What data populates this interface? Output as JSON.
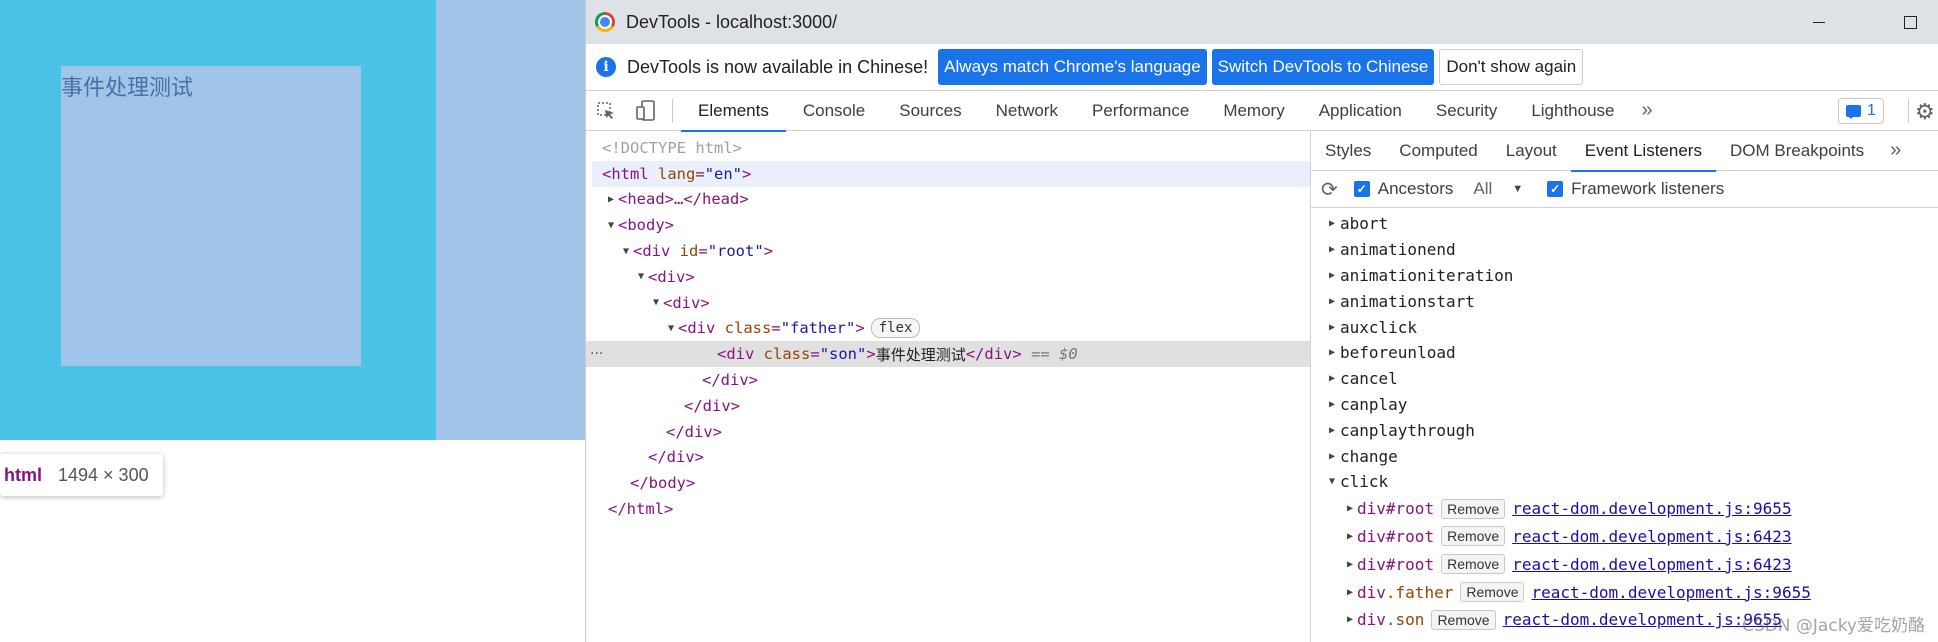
{
  "preview": {
    "son_text": "事件处理测试",
    "tooltip_tag": "html",
    "tooltip_size": "1494 × 300"
  },
  "window": {
    "title": "DevTools - localhost:3000/"
  },
  "infobar": {
    "message": "DevTools is now available in Chinese!",
    "btn_match": "Always match Chrome's language",
    "btn_switch": "Switch DevTools to Chinese",
    "btn_dismiss": "Don't show again"
  },
  "tabs": [
    "Elements",
    "Console",
    "Sources",
    "Network",
    "Performance",
    "Memory",
    "Application",
    "Security",
    "Lighthouse"
  ],
  "active_tab": "Elements",
  "more_tabs": "»",
  "issues_count": "1",
  "dom": {
    "doctype": "<!DOCTYPE html>",
    "html_tag": "<html",
    "html_attr": "lang",
    "html_val": "\"en\"",
    "head": "<head>…</head>",
    "body_open": "<body>",
    "div_open": "<div",
    "id_attr": "id",
    "root_val": "\"root\"",
    "div": "<div>",
    "class_attr": "class",
    "father_val": "\"father\"",
    "flex_badge": "flex",
    "son_val": "\"son\"",
    "son_text": "事件处理测试",
    "div_close": "</div>",
    "selected_marker": "== $0",
    "body_close": "</body>",
    "html_close": "</html>",
    "dots": "···"
  },
  "sidebar": {
    "tabs": [
      "Styles",
      "Computed",
      "Layout",
      "Event Listeners",
      "DOM Breakpoints"
    ],
    "active_tab": "Event Listeners",
    "more": "»",
    "ancestors_label": "Ancestors",
    "filter_value": "All",
    "framework_label": "Framework listeners",
    "events": [
      "abort",
      "animationend",
      "animationiteration",
      "animationstart",
      "auxclick",
      "beforeunload",
      "cancel",
      "canplay",
      "canplaythrough",
      "change"
    ],
    "expanded_event": "click",
    "remove_label": "Remove",
    "listeners": [
      {
        "tag": "div",
        "suffix": "#root",
        "source": "react-dom.development.js:9655"
      },
      {
        "tag": "div",
        "suffix": "#root",
        "source": "react-dom.development.js:6423"
      },
      {
        "tag": "div",
        "suffix": "#root",
        "source": "react-dom.development.js:6423"
      },
      {
        "tag": "div",
        "suffix": ".father",
        "source": "react-dom.development.js:9655"
      },
      {
        "tag": "div",
        "suffix": ".son",
        "source": "react-dom.development.js:9655"
      }
    ],
    "watermark": "CSDN @Jacky爱吃奶酪"
  }
}
